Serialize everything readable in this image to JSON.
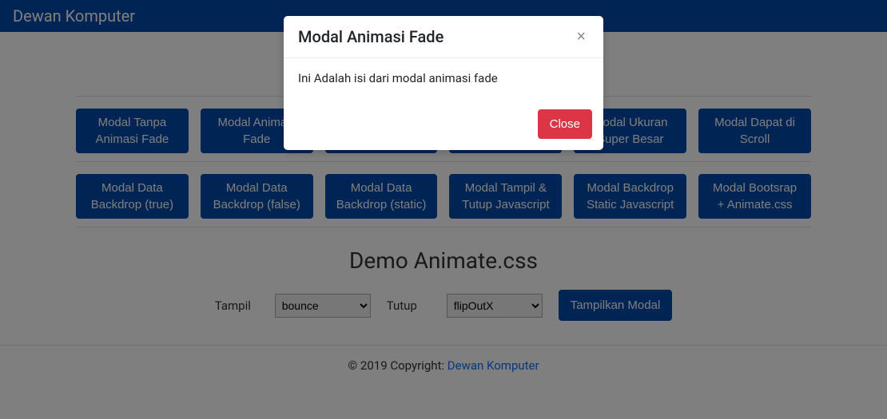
{
  "navbar": {
    "brand": "Dewan Komputer"
  },
  "buttons_row1": [
    "Modal Tanpa Animasi Fade",
    "Modal Animasi Fade",
    "",
    "",
    "Modal Ukuran Super Besar",
    "Modal Dapat di Scroll"
  ],
  "buttons_row2": [
    "Modal Data Backdrop (true)",
    "Modal Data Backdrop (false)",
    "Modal Data Backdrop (static)",
    "Modal Tampil & Tutup Javascript",
    "Modal Backdrop Static Javascript",
    "Modal Bootsrap + Animate.css"
  ],
  "section_title": "Demo Animate.css",
  "form": {
    "label_tampil": "Tampil",
    "select_tampil": "bounce",
    "label_tutup": "Tutup",
    "select_tutup": "flipOutX",
    "button_show": "Tampilkan Modal"
  },
  "footer": {
    "text": "© 2019 Copyright: ",
    "link": "Dewan Komputer"
  },
  "modal": {
    "title": "Modal Animasi Fade",
    "body": "Ini Adalah isi dari modal animasi fade",
    "close": "Close",
    "x": "×"
  }
}
